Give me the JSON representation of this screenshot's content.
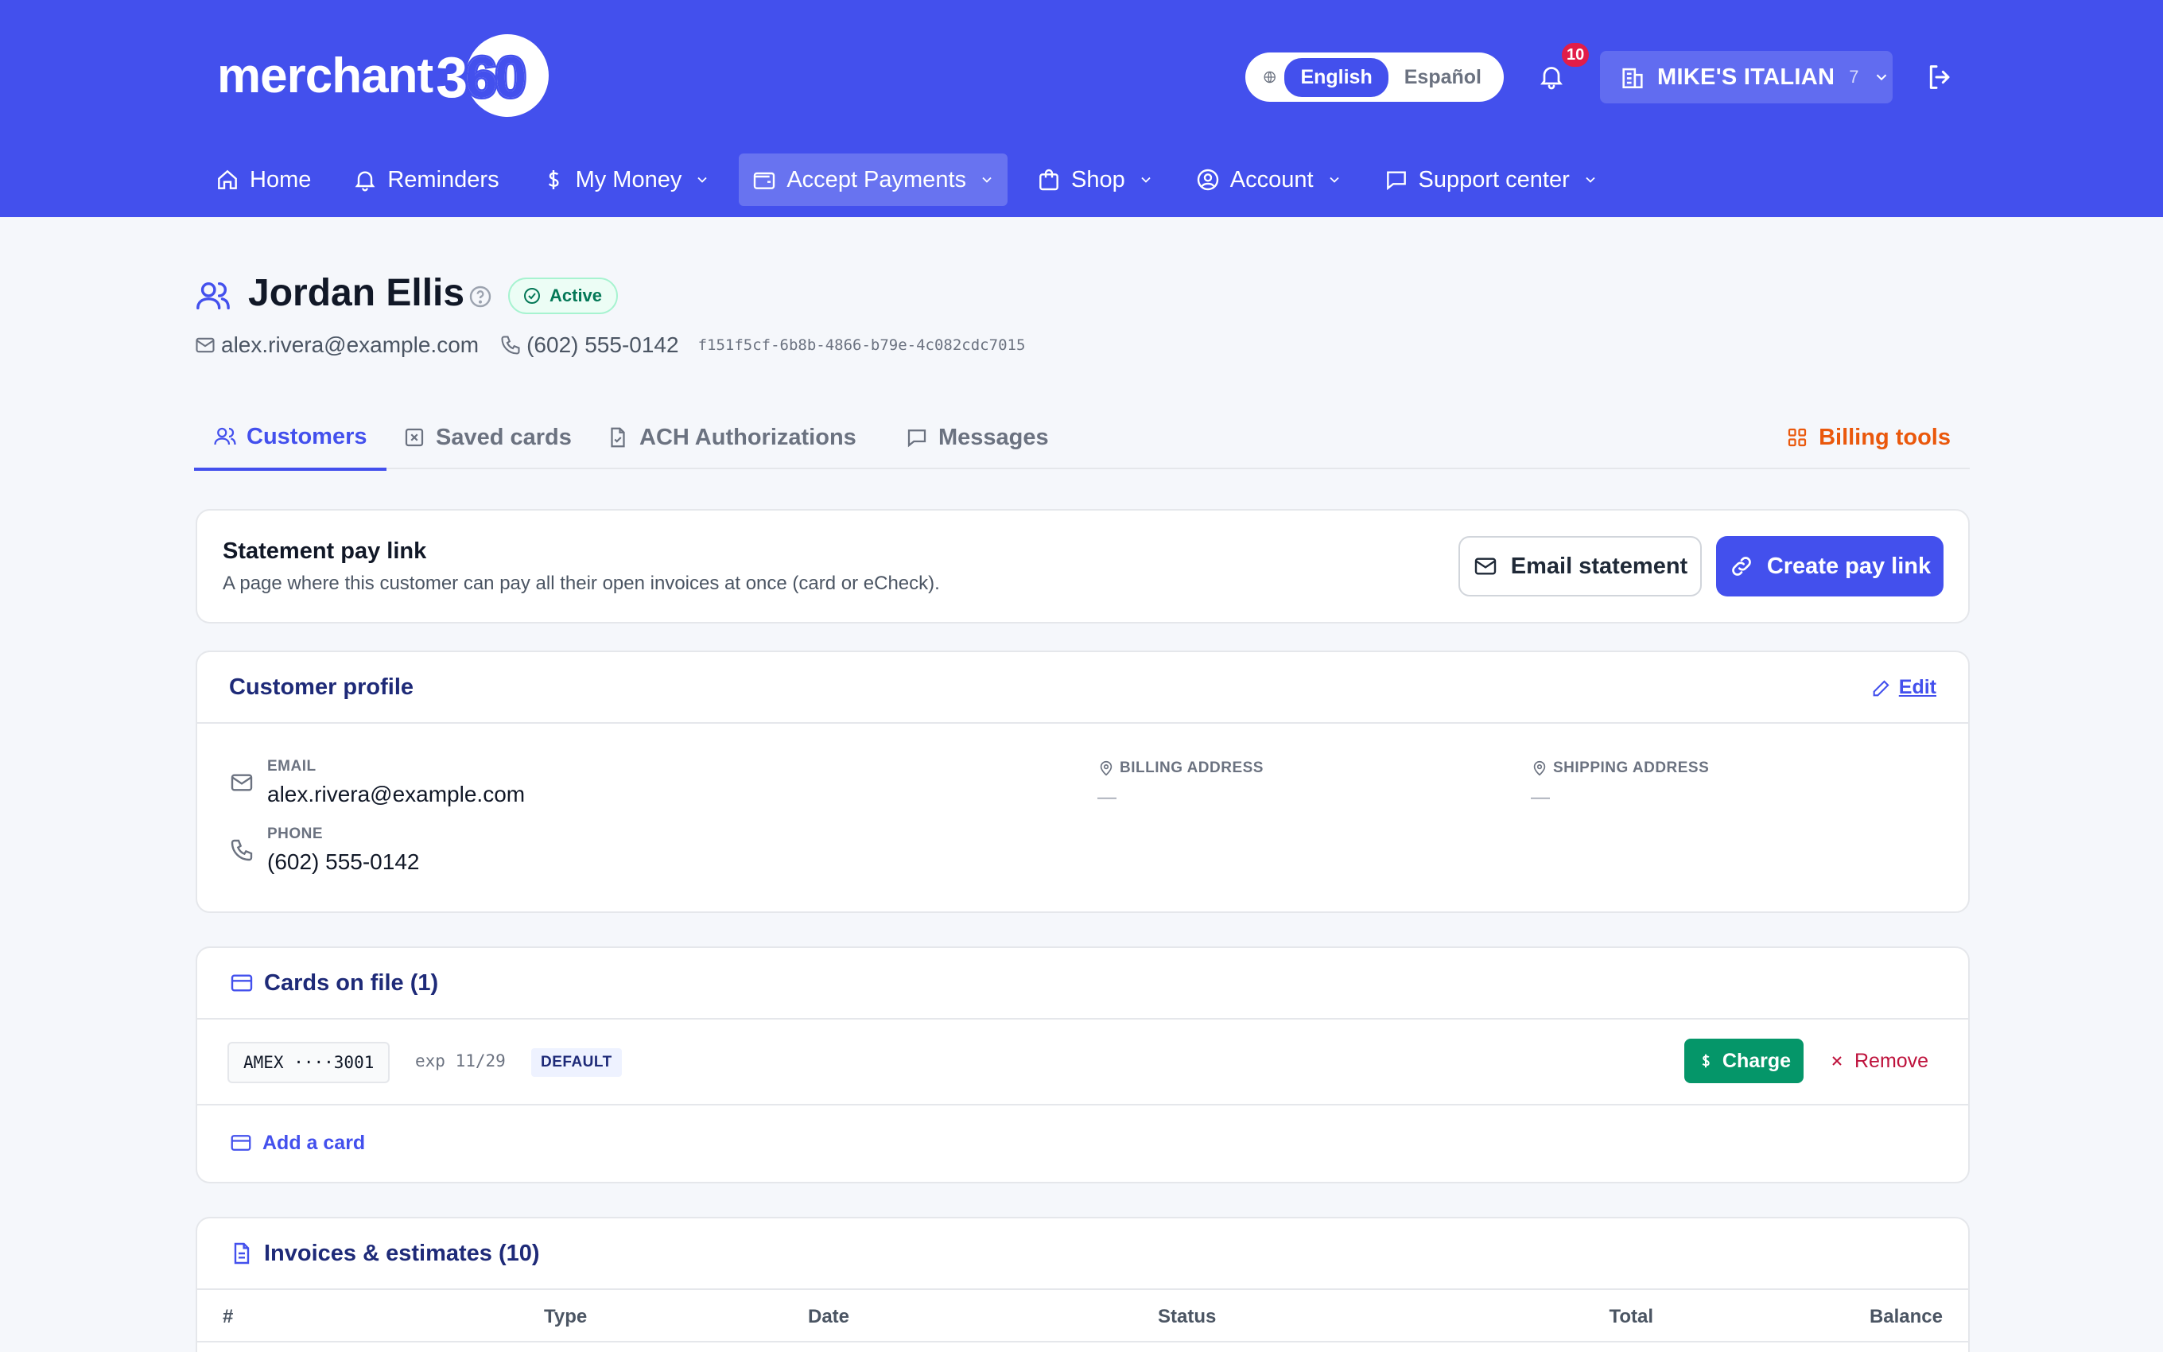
{
  "header": {
    "logo_text": "merchant",
    "logo_number": "360",
    "language": {
      "options": [
        "English",
        "Español"
      ],
      "selected": "English"
    },
    "notifications_count": "10",
    "store": {
      "name": "MIKE'S ITALIAN",
      "count": "7"
    }
  },
  "nav": [
    {
      "label": "Home",
      "icon": "home-icon",
      "dropdown": false
    },
    {
      "label": "Reminders",
      "icon": "bell-icon",
      "dropdown": false
    },
    {
      "label": "My Money",
      "icon": "dollar-icon",
      "dropdown": true
    },
    {
      "label": "Accept Payments",
      "icon": "wallet-icon",
      "dropdown": true,
      "active": true
    },
    {
      "label": "Shop",
      "icon": "shopping-bag-icon",
      "dropdown": true
    },
    {
      "label": "Account",
      "icon": "user-circle-icon",
      "dropdown": true
    },
    {
      "label": "Support center",
      "icon": "chat-icon",
      "dropdown": true
    }
  ],
  "customer": {
    "name": "Jordan Ellis",
    "status": "Active",
    "email": "alex.rivera@example.com",
    "phone": "(602) 555-0142",
    "id": "f151f5cf-6b8b-4866-b79e-4c082cdc7015"
  },
  "tabs": {
    "customers": "Customers",
    "saved_cards": "Saved cards",
    "ach": "ACH Authorizations",
    "messages": "Messages",
    "billing_tools": "Billing tools"
  },
  "paylink": {
    "title": "Statement pay link",
    "subtitle": "A page where this customer can pay all their open invoices at once (card or eCheck).",
    "email_button": "Email statement",
    "create_button": "Create pay link"
  },
  "profile": {
    "title": "Customer profile",
    "edit": "Edit",
    "email_label": "EMAIL",
    "email": "alex.rivera@example.com",
    "phone_label": "PHONE",
    "phone": "(602) 555-0142",
    "billing_label": "BILLING ADDRESS",
    "billing_value": "—",
    "shipping_label": "SHIPPING ADDRESS",
    "shipping_value": "—"
  },
  "cards_on_file": {
    "title": "Cards on file (1)",
    "cards": [
      {
        "brand_last4": "AMEX ····3001",
        "exp": "exp 11/29",
        "badge": "DEFAULT"
      }
    ],
    "charge": "Charge",
    "remove": "Remove",
    "add": "Add a card"
  },
  "invoices": {
    "title": "Invoices & estimates (10)",
    "columns": [
      "#",
      "Type",
      "Date",
      "Status",
      "Total",
      "Balance"
    ]
  },
  "colors": {
    "brand": "#4350ed",
    "accent_orange": "#ea580c",
    "success": "#059669",
    "danger": "#be123c"
  }
}
